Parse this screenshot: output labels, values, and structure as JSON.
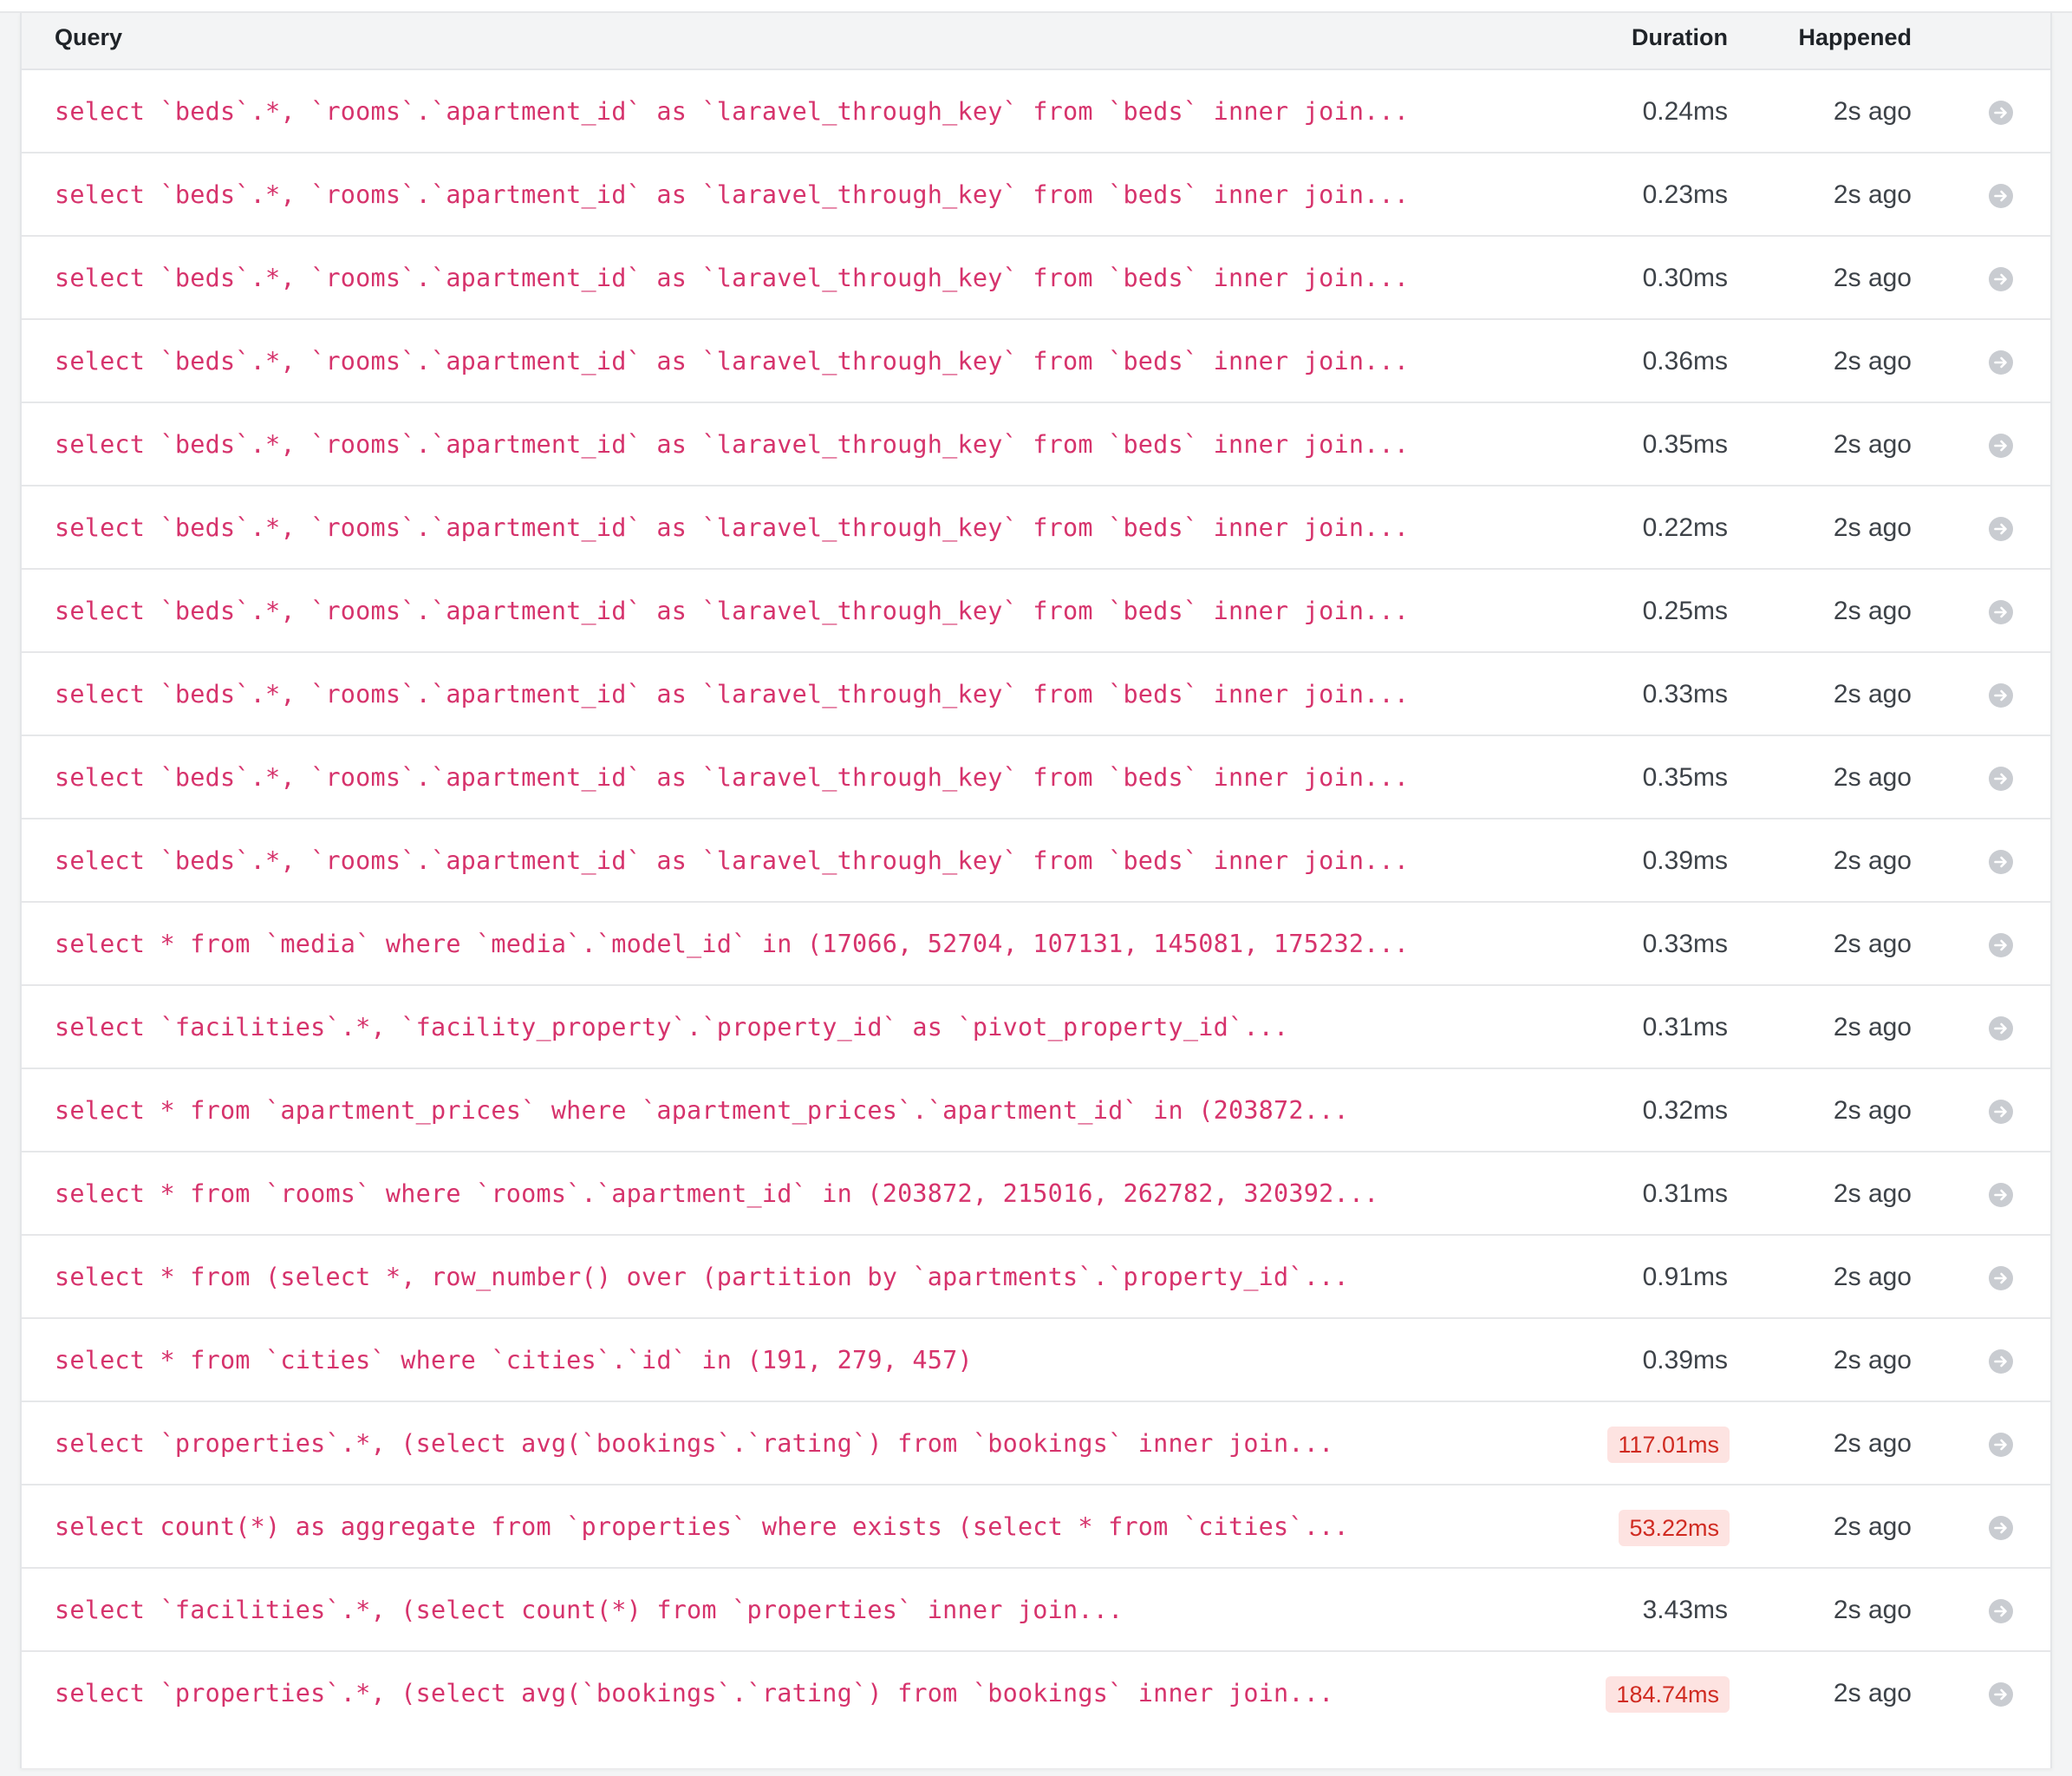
{
  "table": {
    "headers": {
      "query": "Query",
      "duration": "Duration",
      "happened": "Happened"
    },
    "rows": [
      {
        "query": "select `beds`.*, `rooms`.`apartment_id` as `laravel_through_key` from `beds` inner join...",
        "duration": "0.24ms",
        "slow": false,
        "happened": "2s ago"
      },
      {
        "query": "select `beds`.*, `rooms`.`apartment_id` as `laravel_through_key` from `beds` inner join...",
        "duration": "0.23ms",
        "slow": false,
        "happened": "2s ago"
      },
      {
        "query": "select `beds`.*, `rooms`.`apartment_id` as `laravel_through_key` from `beds` inner join...",
        "duration": "0.30ms",
        "slow": false,
        "happened": "2s ago"
      },
      {
        "query": "select `beds`.*, `rooms`.`apartment_id` as `laravel_through_key` from `beds` inner join...",
        "duration": "0.36ms",
        "slow": false,
        "happened": "2s ago"
      },
      {
        "query": "select `beds`.*, `rooms`.`apartment_id` as `laravel_through_key` from `beds` inner join...",
        "duration": "0.35ms",
        "slow": false,
        "happened": "2s ago"
      },
      {
        "query": "select `beds`.*, `rooms`.`apartment_id` as `laravel_through_key` from `beds` inner join...",
        "duration": "0.22ms",
        "slow": false,
        "happened": "2s ago"
      },
      {
        "query": "select `beds`.*, `rooms`.`apartment_id` as `laravel_through_key` from `beds` inner join...",
        "duration": "0.25ms",
        "slow": false,
        "happened": "2s ago"
      },
      {
        "query": "select `beds`.*, `rooms`.`apartment_id` as `laravel_through_key` from `beds` inner join...",
        "duration": "0.33ms",
        "slow": false,
        "happened": "2s ago"
      },
      {
        "query": "select `beds`.*, `rooms`.`apartment_id` as `laravel_through_key` from `beds` inner join...",
        "duration": "0.35ms",
        "slow": false,
        "happened": "2s ago"
      },
      {
        "query": "select `beds`.*, `rooms`.`apartment_id` as `laravel_through_key` from `beds` inner join...",
        "duration": "0.39ms",
        "slow": false,
        "happened": "2s ago"
      },
      {
        "query": "select * from `media` where `media`.`model_id` in (17066, 52704, 107131, 145081, 175232...",
        "duration": "0.33ms",
        "slow": false,
        "happened": "2s ago"
      },
      {
        "query": "select `facilities`.*, `facility_property`.`property_id` as `pivot_property_id`...",
        "duration": "0.31ms",
        "slow": false,
        "happened": "2s ago"
      },
      {
        "query": "select * from `apartment_prices` where `apartment_prices`.`apartment_id` in (203872...",
        "duration": "0.32ms",
        "slow": false,
        "happened": "2s ago"
      },
      {
        "query": "select * from `rooms` where `rooms`.`apartment_id` in (203872, 215016, 262782, 320392...",
        "duration": "0.31ms",
        "slow": false,
        "happened": "2s ago"
      },
      {
        "query": "select * from (select *, row_number() over (partition by `apartments`.`property_id`...",
        "duration": "0.91ms",
        "slow": false,
        "happened": "2s ago"
      },
      {
        "query": "select * from `cities` where `cities`.`id` in (191, 279, 457)",
        "duration": "0.39ms",
        "slow": false,
        "happened": "2s ago"
      },
      {
        "query": "select `properties`.*, (select avg(`bookings`.`rating`) from `bookings` inner join...",
        "duration": "117.01ms",
        "slow": true,
        "happened": "2s ago"
      },
      {
        "query": "select count(*) as aggregate from `properties` where exists (select * from `cities`...",
        "duration": "53.22ms",
        "slow": true,
        "happened": "2s ago"
      },
      {
        "query": "select `facilities`.*, (select count(*) from `properties` inner join...",
        "duration": "3.43ms",
        "slow": false,
        "happened": "2s ago"
      },
      {
        "query": "select `properties`.*, (select avg(`bookings`.`rating`) from `bookings` inner join...",
        "duration": "184.74ms",
        "slow": true,
        "happened": "2s ago"
      }
    ],
    "row_action_icon": "arrow-circle-right-icon"
  },
  "colors": {
    "query_text": "#d6336c",
    "slow_badge_bg": "#fde3e1",
    "slow_badge_text": "#d02b21",
    "icon": "#c9ccd1"
  }
}
